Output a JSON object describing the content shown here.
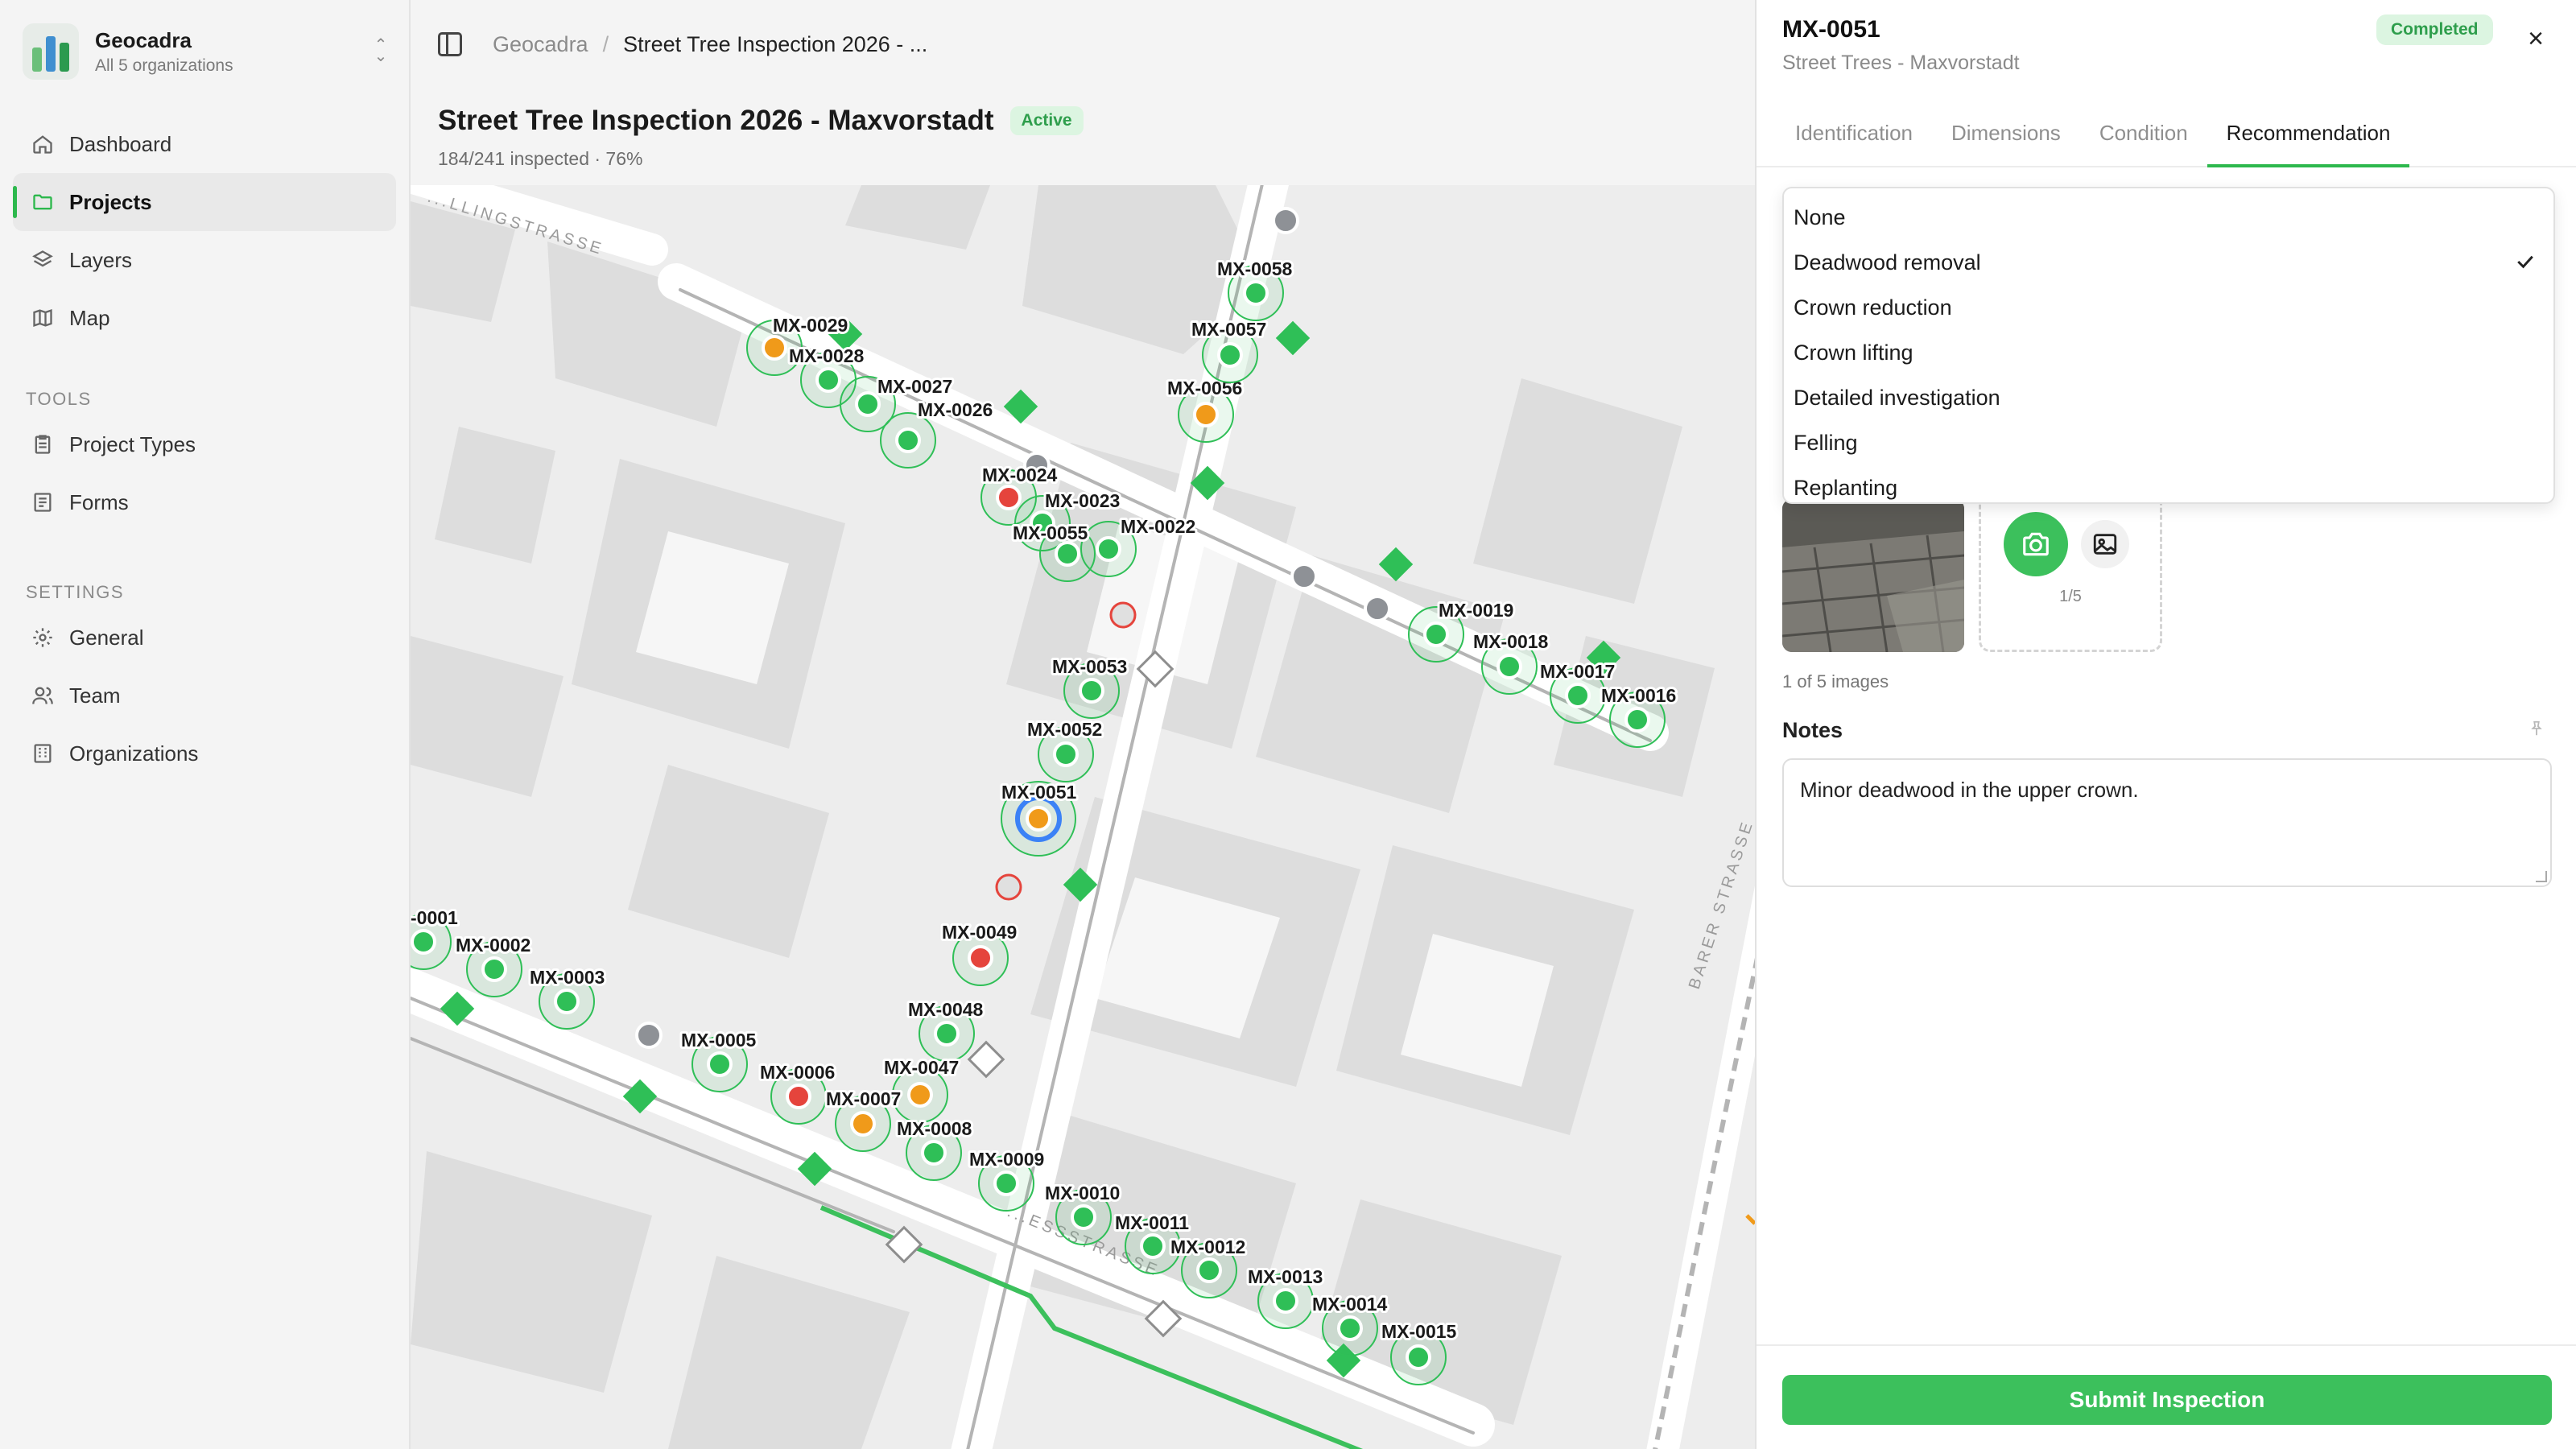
{
  "org": {
    "name": "Geocadra",
    "subtitle": "All 5 organizations"
  },
  "nav": {
    "main": [
      {
        "label": "Dashboard",
        "icon": "home-icon"
      },
      {
        "label": "Projects",
        "icon": "folder-icon",
        "active": true
      },
      {
        "label": "Layers",
        "icon": "layers-icon"
      },
      {
        "label": "Map",
        "icon": "map-icon"
      }
    ],
    "tools_heading": "TOOLS",
    "tools": [
      {
        "label": "Project Types",
        "icon": "clipboard-icon"
      },
      {
        "label": "Forms",
        "icon": "form-icon"
      }
    ],
    "settings_heading": "SETTINGS",
    "settings": [
      {
        "label": "General",
        "icon": "gear-icon"
      },
      {
        "label": "Team",
        "icon": "users-icon"
      },
      {
        "label": "Organizations",
        "icon": "building-icon"
      }
    ]
  },
  "breadcrumb": {
    "root": "Geocadra",
    "separator": "/",
    "current": "Street Tree Inspection 2026 - ..."
  },
  "project": {
    "title": "Street Tree Inspection 2026 - Maxvorstadt",
    "status": "Active",
    "progress_text": "184/241 inspected · 76%",
    "progress": 0.76
  },
  "map": {
    "street_labels": [
      "...LLINGSTRASSE",
      "BARER STRASSE",
      "...ESSSTRASSE"
    ],
    "colors": {
      "green": "#2fbf57",
      "orange": "#f09a1a",
      "red": "#e5443c",
      "gray": "#8e9196",
      "selected_ring": "#3b82f6"
    },
    "trees": [
      {
        "id": "MX-0029",
        "status": "orange"
      },
      {
        "id": "MX-0028",
        "status": "green"
      },
      {
        "id": "MX-0027",
        "status": "green"
      },
      {
        "id": "MX-0026",
        "status": "green"
      },
      {
        "id": "MX-0024",
        "status": "red"
      },
      {
        "id": "MX-0023",
        "status": "green"
      },
      {
        "id": "MX-0022",
        "status": "green"
      },
      {
        "id": "MX-0055",
        "status": "green"
      },
      {
        "id": "MX-0056",
        "status": "orange"
      },
      {
        "id": "MX-0057",
        "status": "green"
      },
      {
        "id": "MX-0058",
        "status": "green"
      },
      {
        "id": "MX-0053",
        "status": "green"
      },
      {
        "id": "MX-0052",
        "status": "green"
      },
      {
        "id": "MX-0051",
        "status": "orange",
        "selected": true
      },
      {
        "id": "MX-0049",
        "status": "red"
      },
      {
        "id": "MX-0048",
        "status": "green"
      },
      {
        "id": "MX-0047",
        "status": "orange"
      },
      {
        "id": "MX-0019",
        "status": "green"
      },
      {
        "id": "MX-0018",
        "status": "green"
      },
      {
        "id": "MX-0017",
        "status": "green"
      },
      {
        "id": "MX-0016",
        "status": "green"
      },
      {
        "id": "-0001",
        "status": "green"
      },
      {
        "id": "MX-0002",
        "status": "green"
      },
      {
        "id": "MX-0003",
        "status": "green"
      },
      {
        "id": "MX-0005",
        "status": "green"
      },
      {
        "id": "MX-0006",
        "status": "red"
      },
      {
        "id": "MX-0007",
        "status": "orange"
      },
      {
        "id": "MX-0008",
        "status": "green"
      },
      {
        "id": "MX-0009",
        "status": "green"
      },
      {
        "id": "MX-0010",
        "status": "green"
      },
      {
        "id": "MX-0011",
        "status": "green"
      },
      {
        "id": "MX-0012",
        "status": "green"
      },
      {
        "id": "MX-0013",
        "status": "green"
      },
      {
        "id": "MX-0014",
        "status": "green"
      },
      {
        "id": "MX-0015",
        "status": "green"
      }
    ]
  },
  "panel": {
    "id": "MX-0051",
    "subtitle": "Street Trees - Maxvorstadt",
    "status": "Completed",
    "close_icon": "×",
    "tabs": [
      "Identification",
      "Dimensions",
      "Condition",
      "Recommendation"
    ],
    "active_tab": "Recommendation",
    "dropdown": {
      "options": [
        "None",
        "Deadwood removal",
        "Crown reduction",
        "Crown lifting",
        "Detailed investigation",
        "Felling",
        "Replanting"
      ],
      "selected": "Deadwood removal"
    },
    "photo_counter": "1/5",
    "images_text": "1 of 5 images",
    "notes_label": "Notes",
    "notes_value": "Minor deadwood in the upper crown.",
    "submit_label": "Submit Inspection"
  }
}
